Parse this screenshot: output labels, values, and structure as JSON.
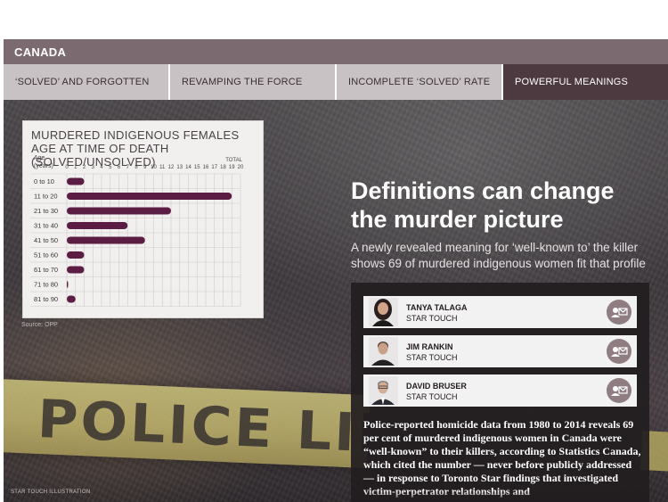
{
  "section": {
    "label": "CANADA"
  },
  "tabs": [
    {
      "label": "‘SOLVED’ AND FORGOTTEN",
      "active": false
    },
    {
      "label": "REVAMPING THE FORCE",
      "active": false
    },
    {
      "label": "INCOMPLETE ‘SOLVED’ RATE",
      "active": false
    },
    {
      "label": "POWERFUL MEANINGS",
      "active": true
    }
  ],
  "hero": {
    "tape_text": "POLICE LINE",
    "credit": "STAR TOUCH ILLUSTRATION",
    "headline": "Definitions can change the murder picture",
    "dek": "A newly revealed meaning for ‘well-known to’ the killer shows 69 of murdered indigenous women fit that profile"
  },
  "chart": {
    "title": "MURDERED INDIGENOUS FEMALES AGE AT TIME OF DEATH (SOLVED/UNSOLVED)",
    "age_label_line1": "Age",
    "age_label_line2": "(years)",
    "total_label": "TOTAL",
    "source": "Source: OPP"
  },
  "chart_data": {
    "type": "bar",
    "title": "MURDERED INDIGENOUS FEMALES AGE AT TIME OF DEATH (SOLVED/UNSOLVED)",
    "ylabel": "Age (years)",
    "xlabel": "TOTAL",
    "categories": [
      "0 to 10",
      "11 to 20",
      "21 to 30",
      "31 to 40",
      "41 to 50",
      "51 to 60",
      "61 to 70",
      "71 to 80",
      "81 to 90"
    ],
    "values": [
      2,
      19,
      12,
      7,
      9,
      2,
      2,
      0,
      1
    ],
    "xlim": [
      0,
      20
    ],
    "xticks": [
      "0",
      "1",
      "2",
      "3",
      "4",
      "5",
      "6",
      "7",
      "8",
      "9",
      "10",
      "11",
      "12",
      "13",
      "14",
      "15",
      "16",
      "17",
      "18",
      "19",
      "20"
    ],
    "grid": true,
    "bar_color": "#5c1d44"
  },
  "authors": [
    {
      "name": "TANYA TALAGA",
      "role": "STAR TOUCH",
      "contact_icon": "contact-card-icon"
    },
    {
      "name": "JIM RANKIN",
      "role": "STAR TOUCH",
      "contact_icon": "contact-card-icon"
    },
    {
      "name": "DAVID BRUSER",
      "role": "STAR TOUCH",
      "contact_icon": "contact-card-icon"
    }
  ],
  "body": {
    "text": "Police-reported homicide data from 1980 to 2014 reveals 69 per cent of murdered indigenous women in Canada were “well-known” to their killers, according to Statistics Canada, which cited the number — never before publicly addressed — in response to Toronto Star findings that investigated victim-perpetrator relationships and"
  },
  "colors": {
    "section_bar": "#7b6a70",
    "tab_inactive": "#c9c2c4",
    "tab_active": "#4d3a40",
    "bar": "#5c1d44",
    "contact_button": "#8f7d82"
  }
}
